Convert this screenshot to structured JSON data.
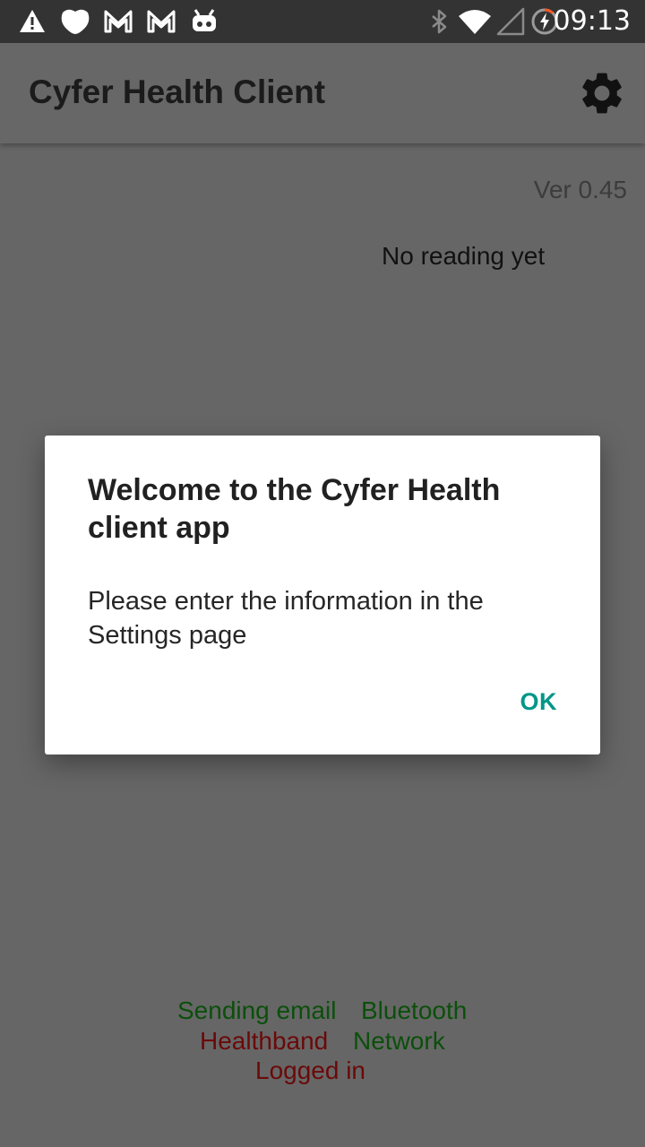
{
  "status_bar": {
    "time": "09:13",
    "left_icons": [
      "warning-icon",
      "shield-icon",
      "gmail-icon",
      "gmail-icon",
      "android-icon"
    ],
    "right_icons": [
      "bluetooth-icon",
      "wifi-icon",
      "signal-icon",
      "battery-charging-icon"
    ]
  },
  "app_bar": {
    "title": "Cyfer Health Client",
    "settings_icon": "gear-icon"
  },
  "main": {
    "version": "Ver 0.45",
    "reading": "No reading yet"
  },
  "status": {
    "sending_email": "Sending email",
    "bluetooth": "Bluetooth",
    "healthband": "Healthband",
    "network": "Network",
    "logged_in": "Logged in"
  },
  "dialog": {
    "title": "Welcome to the Cyfer Health client app",
    "message": "Please enter the information in the Settings page",
    "ok_label": "OK"
  },
  "colors": {
    "accent": "#009688",
    "status_ok": "#0b4f0b",
    "status_bad": "#6b0909"
  }
}
